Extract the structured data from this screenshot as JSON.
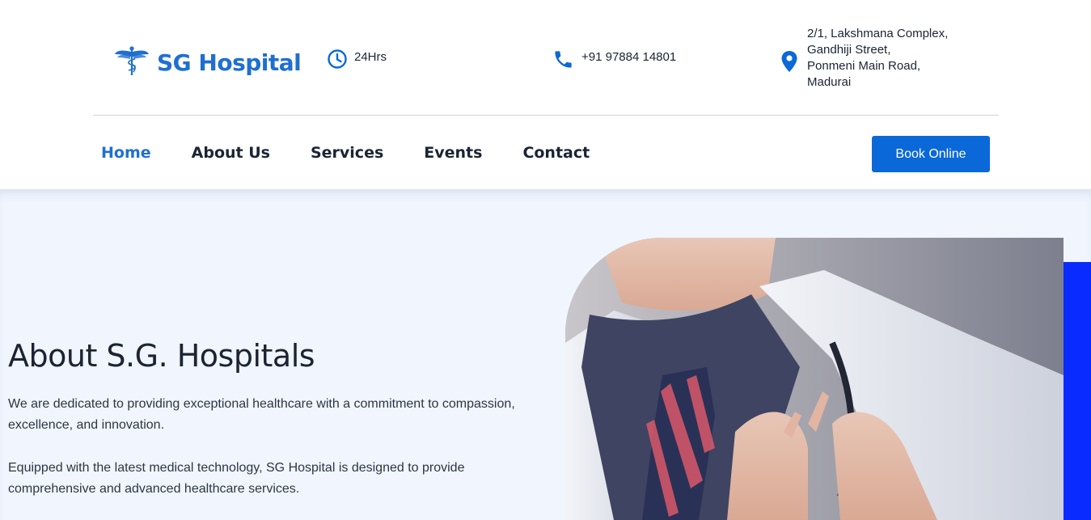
{
  "brand": {
    "name": "SG Hospital",
    "color": "#1f6fd1"
  },
  "contact": {
    "hours": "24Hrs",
    "phone": "+91 97884 14801",
    "address_lines": [
      "2/1, Lakshmana Complex,",
      "Gandhiji Street,",
      "Ponmeni Main Road,",
      "Madurai"
    ]
  },
  "nav": {
    "items": [
      {
        "label": "Home",
        "active": true
      },
      {
        "label": "About Us",
        "active": false
      },
      {
        "label": "Services",
        "active": false
      },
      {
        "label": "Events",
        "active": false
      },
      {
        "label": "Contact",
        "active": false
      }
    ],
    "book_label": "Book Online"
  },
  "hero": {
    "title": "About S.G. Hospitals",
    "paragraph1": "We are dedicated to providing exceptional healthcare with a commitment to compassion, excellence, and innovation.",
    "paragraph2": "Equipped with the latest medical technology, SG Hospital is designed to provide comprehensive and advanced healthcare services."
  },
  "icons": {
    "hours": "clock-icon",
    "phone": "phone-icon",
    "address": "map-pin-icon",
    "logo": "caduceus-icon"
  },
  "colors": {
    "accent": "#0a68d8",
    "hero_bg": "#f0f5fe",
    "side_bar": "#0a2bff"
  }
}
